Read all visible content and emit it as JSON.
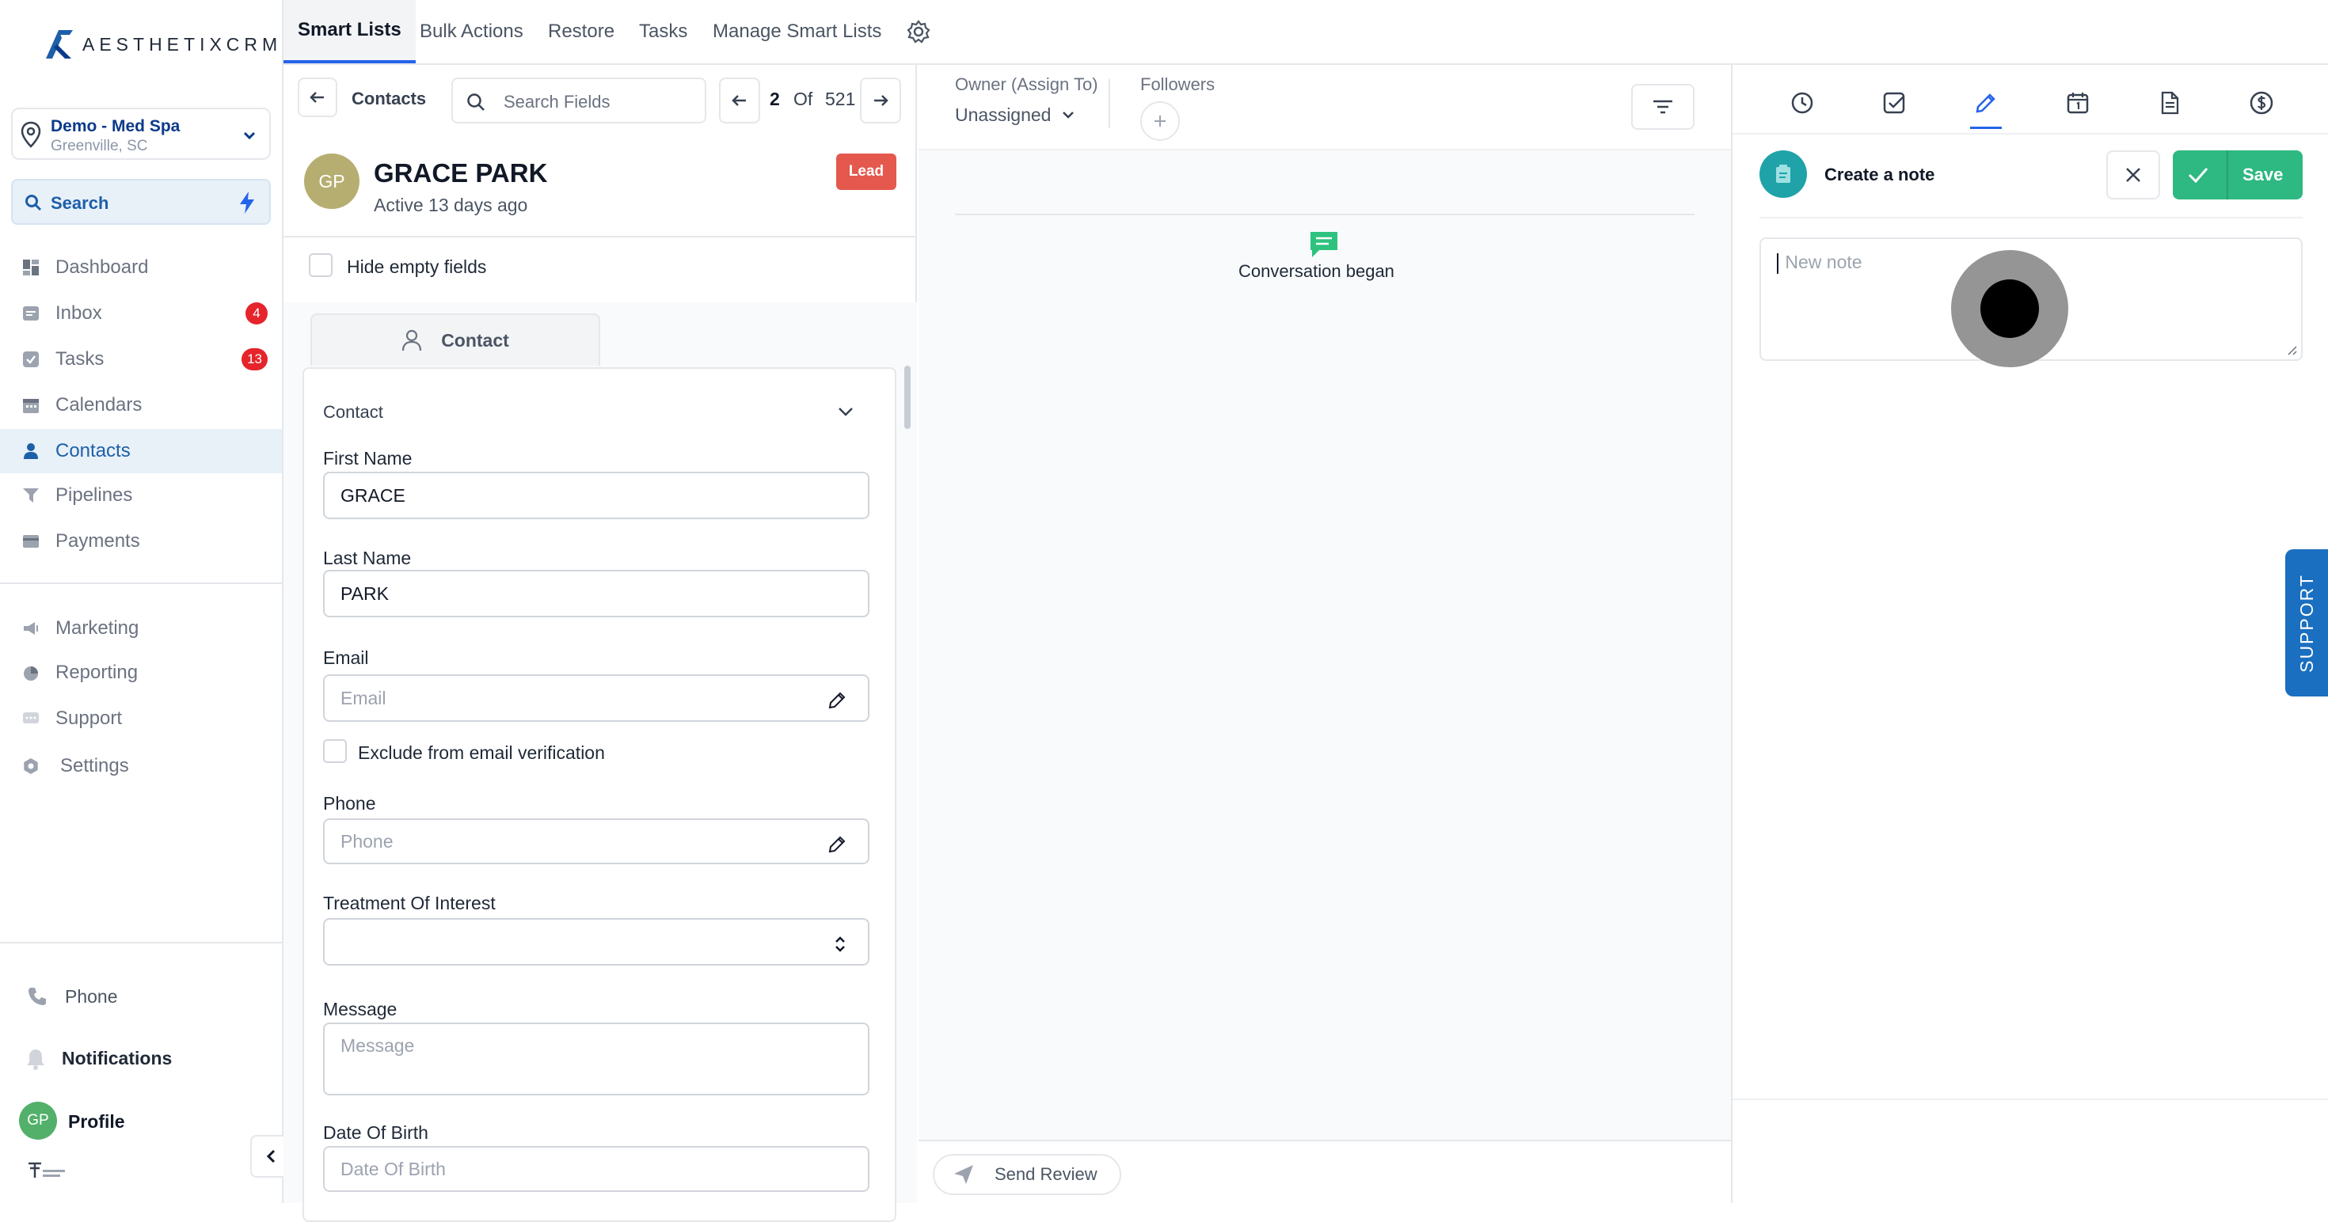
{
  "brand": {
    "logo_text": "AESTHETIXCRM"
  },
  "location": {
    "name": "Demo - Med Spa",
    "city": "Greenville, SC"
  },
  "search": {
    "label": "Search"
  },
  "nav": [
    {
      "label": "Dashboard",
      "icon": "dashboard-icon"
    },
    {
      "label": "Inbox",
      "icon": "inbox-icon",
      "badge": "4"
    },
    {
      "label": "Tasks",
      "icon": "tasks-icon",
      "badge": "13"
    },
    {
      "label": "Calendars",
      "icon": "calendar-icon"
    },
    {
      "label": "Contacts",
      "icon": "contacts-icon",
      "active": true
    },
    {
      "label": "Pipelines",
      "icon": "pipelines-icon"
    },
    {
      "label": "Payments",
      "icon": "payments-icon"
    }
  ],
  "nav2": [
    {
      "label": "Marketing",
      "icon": "marketing-icon"
    },
    {
      "label": "Reporting",
      "icon": "reporting-icon"
    },
    {
      "label": "Support",
      "icon": "support-icon"
    },
    {
      "label": "Settings",
      "icon": "settings-icon"
    }
  ],
  "bottom": {
    "phone": "Phone",
    "notifications": "Notifications",
    "profile": "Profile",
    "profile_initials": "GP"
  },
  "tabs": [
    "Smart Lists",
    "Bulk Actions",
    "Restore",
    "Tasks",
    "Manage Smart Lists"
  ],
  "contact_panel": {
    "back_label": "Contacts",
    "search_placeholder": "Search Fields",
    "pager": {
      "current": "2",
      "of": "Of",
      "total": "521"
    },
    "initials": "GP",
    "name": "GRACE PARK",
    "active": "Active 13 days ago",
    "badge": "Lead",
    "hide_empty": "Hide empty fields",
    "tab_label": "Contact",
    "section_title": "Contact",
    "fields": {
      "first_name_label": "First Name",
      "first_name_value": "GRACE",
      "last_name_label": "Last Name",
      "last_name_value": "PARK",
      "email_label": "Email",
      "email_placeholder": "Email",
      "exclude_email": "Exclude from email verification",
      "phone_label": "Phone",
      "phone_placeholder": "Phone",
      "treatment_label": "Treatment Of Interest",
      "message_label": "Message",
      "message_placeholder": "Message",
      "dob_label": "Date Of Birth",
      "dob_placeholder": "Date Of Birth"
    }
  },
  "center": {
    "owner_label": "Owner (Assign To)",
    "owner_value": "Unassigned",
    "followers_label": "Followers",
    "event": "Conversation began",
    "send_review": "Send Review"
  },
  "right_panel": {
    "title": "Create a note",
    "save": "Save",
    "note_placeholder": "New note"
  },
  "support_tab": "SUPPORT",
  "colors": {
    "accent": "#2563eb",
    "primary_nav": "#1d5fa8",
    "save_green": "#2eb882",
    "badge_red": "#e5242b",
    "lead": "#e4584d",
    "support": "#1a6fc0"
  }
}
